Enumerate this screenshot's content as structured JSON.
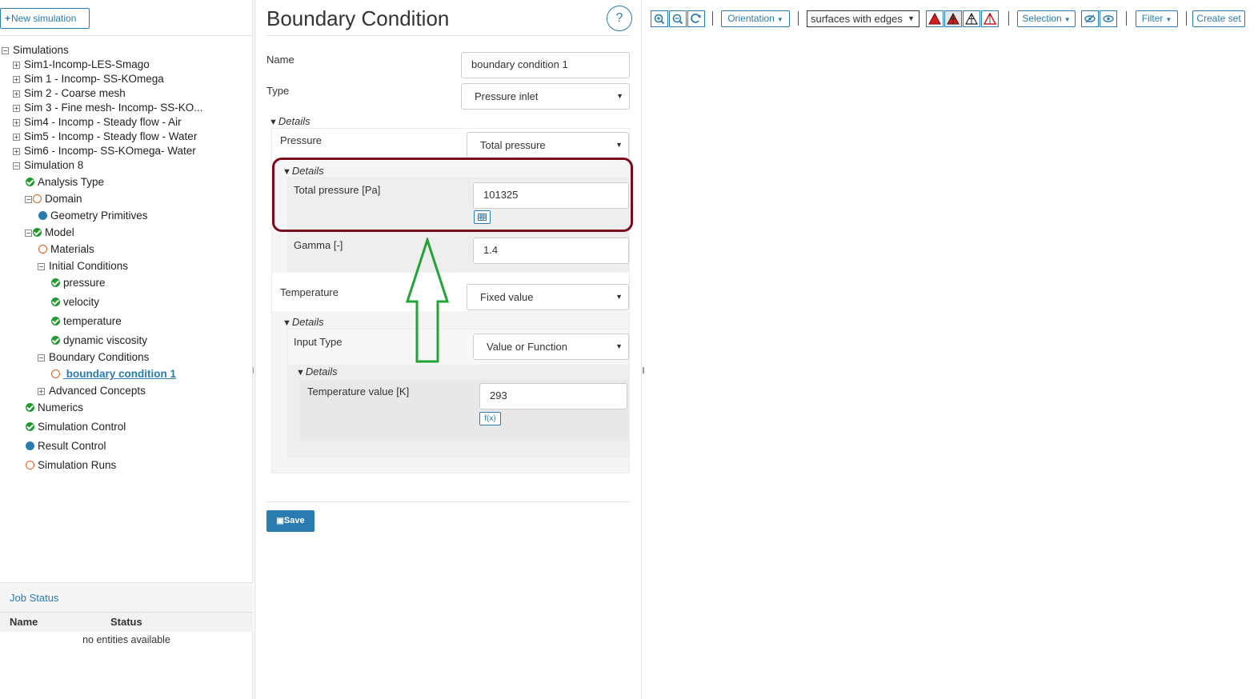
{
  "left": {
    "new_simulation_label": "New simulation",
    "tree_root": "Simulations",
    "simulations": [
      "Sim1-Incomp-LES-Smago",
      "Sim 1 - Incomp- SS-KOmega",
      "Sim 2 - Coarse mesh",
      "Sim 3 - Fine mesh- Incomp- SS-KO...",
      "Sim4 - Incomp - Steady flow - Air",
      "Sim5 - Incomp - Steady flow - Water",
      "Sim6 - Incomp- SS-KOmega- Water",
      "Simulation 8"
    ],
    "sim8_children": {
      "analysis_type": "Analysis Type",
      "domain": "Domain",
      "geometry_primitives": "Geometry Primitives",
      "model": "Model",
      "materials": "Materials",
      "initial_conditions": "Initial Conditions",
      "pressure": "pressure",
      "velocity": "velocity",
      "temperature": "temperature",
      "dynamic_viscosity": "dynamic viscosity",
      "boundary_conditions": "Boundary Conditions",
      "boundary_condition_1": " boundary condition 1",
      "advanced_concepts": "Advanced Concepts",
      "numerics": "Numerics",
      "simulation_control": "Simulation Control",
      "result_control": "Result Control",
      "simulation_runs": "Simulation Runs"
    },
    "job_status": {
      "title": "Job Status",
      "col_name": "Name",
      "col_status": "Status",
      "empty": "no entities available"
    }
  },
  "form": {
    "title": "Boundary Condition",
    "help": "?",
    "name_label": "Name",
    "name_value": "boundary condition 1",
    "type_label": "Type",
    "type_value": "Pressure inlet",
    "details_label": "Details",
    "pressure_label": "Pressure",
    "pressure_value": "Total pressure",
    "total_pressure_label": "Total pressure [Pa]",
    "total_pressure_value": "101325",
    "gamma_label": "Gamma [-]",
    "gamma_value": "1.4",
    "temperature_label": "Temperature",
    "temperature_value": "Fixed value",
    "input_type_label": "Input Type",
    "input_type_value": "Value or Function",
    "temperature_value_label": "Temperature value [K]",
    "temperature_value_value": "293",
    "fx_label": "f(x)",
    "save_label": "Save"
  },
  "toolbar": {
    "orientation": "Orientation",
    "surfaces": "surfaces with edges",
    "selection": "Selection",
    "filter": "Filter",
    "create_set": "Create set"
  },
  "colors": {
    "accent": "#2a7bb0",
    "ok": "#1f9a2e",
    "empty_status": "#e06020",
    "highlight": "#7b0a1e",
    "arrow": "#21a336"
  }
}
